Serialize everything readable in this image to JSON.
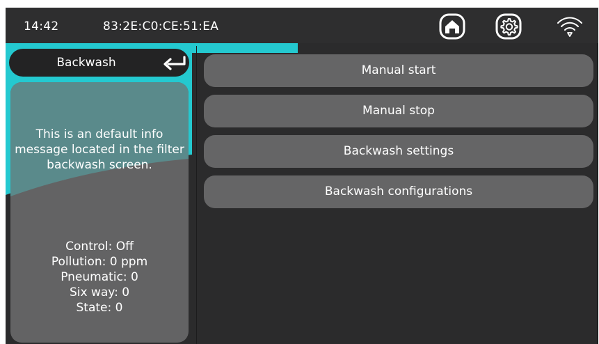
{
  "status_bar": {
    "time": "14:42",
    "mac_address": "83:2E:C0:CE:51:EA",
    "icons": [
      "home-icon",
      "settings-gear-icon",
      "wifi-icon"
    ]
  },
  "left_panel": {
    "title": "Backwash",
    "back_icon": "return-arrow-icon",
    "info_message": "This is an default info message located in the filter backwash screen.",
    "status_lines": [
      "Control: Off",
      "Pollution: 0 ppm",
      "Pneumatic: 0",
      "Six way: 0",
      "State: 0"
    ]
  },
  "menu": {
    "items": [
      {
        "label": "Manual start"
      },
      {
        "label": "Manual stop"
      },
      {
        "label": "Backwash settings"
      },
      {
        "label": "Backwash configurations"
      }
    ]
  },
  "colors": {
    "background": "#2b2b2c",
    "accent_teal": "#24c9d0",
    "button": "#656566",
    "info_top": "#5a8a8b"
  }
}
